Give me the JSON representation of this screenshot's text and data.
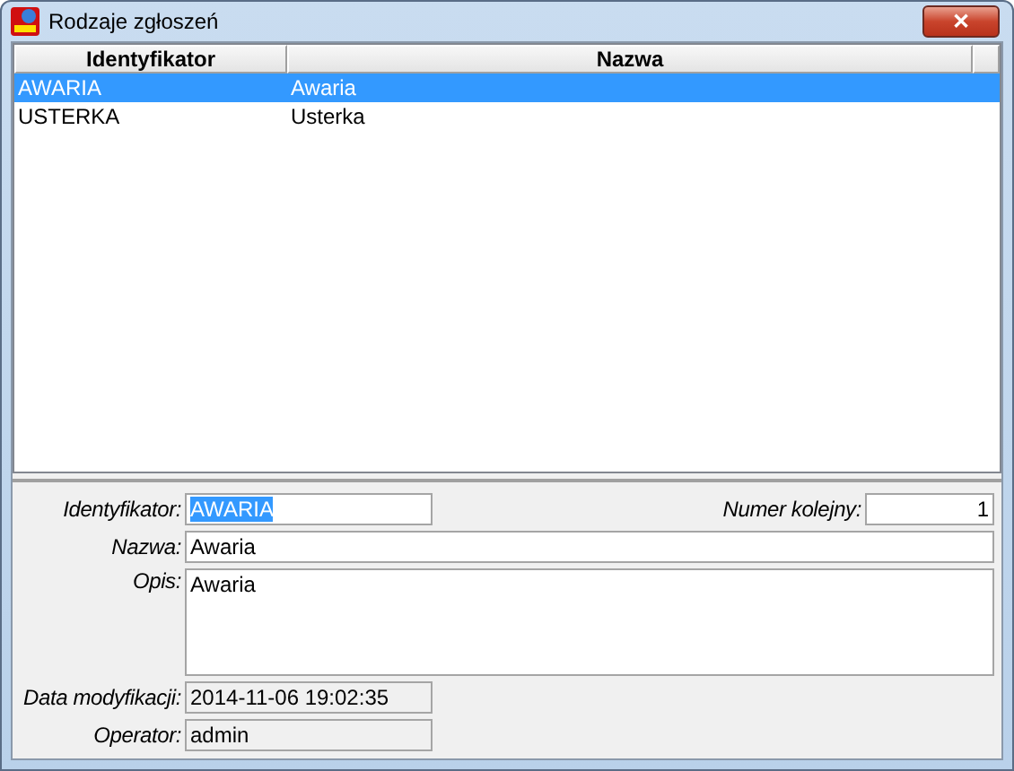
{
  "window": {
    "title": "Rodzaje zgłoszeń",
    "close": "✕"
  },
  "table": {
    "columns": [
      "Identyfikator",
      "Nazwa"
    ],
    "rows": [
      {
        "cells": [
          "AWARIA",
          "Awaria"
        ],
        "selected": true
      },
      {
        "cells": [
          "USTERKA",
          "Usterka"
        ],
        "selected": false
      }
    ]
  },
  "form": {
    "fields": [
      {
        "label": "Identyfikator:",
        "value": "AWARIA",
        "kind": "short",
        "readonly": false,
        "text_selected": true
      },
      {
        "label": "Numer kolejny:",
        "value": "1",
        "kind": "number",
        "readonly": false,
        "text_selected": false
      },
      {
        "label": "Nazwa:",
        "value": "Awaria",
        "kind": "wide",
        "readonly": false,
        "text_selected": false
      },
      {
        "label": "Opis:",
        "value": "Awaria",
        "kind": "memo",
        "readonly": false,
        "text_selected": false
      },
      {
        "label": "Data modyfikacji:",
        "value": "2014-11-06 19:02:35",
        "kind": "short",
        "readonly": true,
        "text_selected": false
      },
      {
        "label": "Operator:",
        "value": "admin",
        "kind": "short",
        "readonly": true,
        "text_selected": false
      }
    ]
  }
}
